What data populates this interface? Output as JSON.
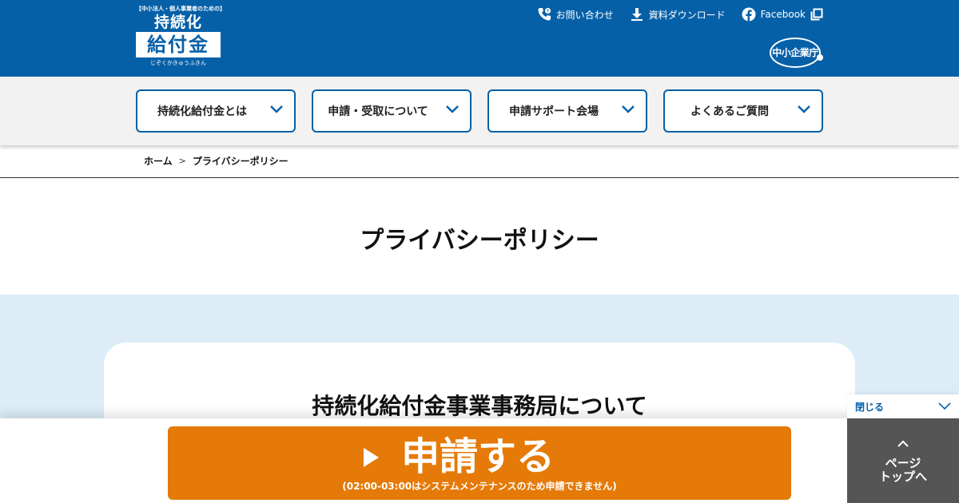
{
  "header": {
    "logo": {
      "tag": "【中小法人・個人事業者のための】",
      "line1": "持続化",
      "line2": "給付金",
      "reading": "じぞくかきゅうふきん"
    },
    "utility": {
      "contact": "お問い合わせ",
      "download": "資料ダウンロード",
      "facebook": "Facebook"
    },
    "agency_logo": "中小企業庁"
  },
  "nav": {
    "items": [
      {
        "label": "持続化給付金とは"
      },
      {
        "label": "申請・受取について"
      },
      {
        "label": "申請サポート会場"
      },
      {
        "label": "よくあるご質問"
      }
    ]
  },
  "breadcrumb": {
    "home": "ホーム",
    "separator": ">",
    "current": "プライバシーポリシー"
  },
  "main": {
    "page_title": "プライバシーポリシー",
    "section_title": "持続化給付金事業事務局について"
  },
  "footer_bar": {
    "apply_label": "申請する",
    "apply_note": "(02:00-03:00はシステムメンテナンスのため申請できません)",
    "close_label": "閉じる",
    "to_top_line1": "ページ",
    "to_top_line2": "トップへ"
  },
  "colors": {
    "brand_blue": "#0660a8",
    "apply_orange": "#e57a08",
    "band_blue": "#ddedf7",
    "to_top_gray": "#555555"
  }
}
